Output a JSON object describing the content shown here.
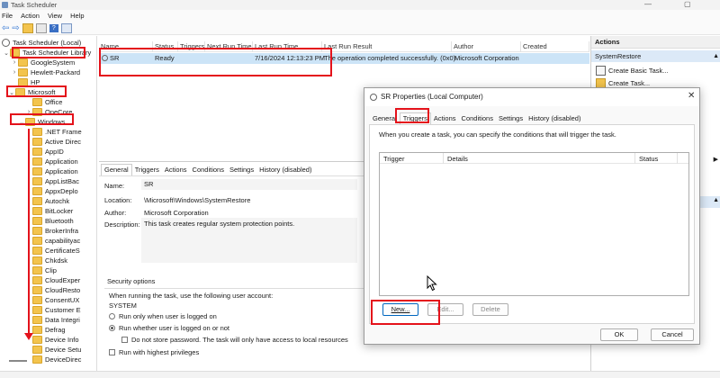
{
  "window": {
    "title": "Task Scheduler"
  },
  "menu": {
    "file": "File",
    "action": "Action",
    "view": "View",
    "help": "Help"
  },
  "tree": {
    "root": "Task Scheduler (Local)",
    "library": "Task Scheduler Library",
    "googlesystem": "GoogleSystem",
    "hp_full": "Hewlett-Packard",
    "hp": "HP",
    "microsoft": "Microsoft",
    "office": "Office",
    "onecore": "OneCore",
    "windows": "Windows",
    "children": [
      ".NET Frame",
      "Active Direc",
      "AppID",
      "Application",
      "Application",
      "AppListBac",
      "AppxDeplo",
      "Autochk",
      "BitLocker",
      "Bluetooth",
      "BrokerInfra",
      "capabilityac",
      "CertificateS",
      "Chkdsk",
      "Clip",
      "CloudExper",
      "CloudResto",
      "ConsentUX",
      "Customer E",
      "Data Integri",
      "Defrag",
      "Device Info",
      "Device Setu",
      "DeviceDirec"
    ]
  },
  "tasklist": {
    "columns": [
      "Name",
      "Status",
      "Triggers",
      "Next Run Time",
      "Last Run Time",
      "Last Run Result",
      "Author",
      "Created"
    ],
    "row": {
      "name": "SR",
      "status": "Ready",
      "last_run": "7/16/2024 12:13:23 PM",
      "result": "The operation completed successfully. (0x0)",
      "author": "Microsoft Corporation"
    }
  },
  "details": {
    "tabs": [
      "General",
      "Triggers",
      "Actions",
      "Conditions",
      "Settings",
      "History (disabled)"
    ],
    "name_label": "Name:",
    "name_value": "SR",
    "location_label": "Location:",
    "location_value": "\\Microsoft\\Windows\\SystemRestore",
    "author_label": "Author:",
    "author_value": "Microsoft Corporation",
    "desc_label": "Description:",
    "desc_value": "This task creates regular system protection points.",
    "security_title": "Security options",
    "security_account_label": "When running the task, use the following user account:",
    "account": "SYSTEM",
    "opt_logged_on": "Run only when user is logged on",
    "opt_logged_or_not": "Run whether user is logged on or not",
    "opt_no_password": "Do not store password.  The task will only have access to local resources",
    "opt_highest": "Run with highest privileges"
  },
  "actions": {
    "header": "Actions",
    "section": "SystemRestore",
    "items": [
      "Create Basic Task...",
      "Create Task..."
    ]
  },
  "dialog": {
    "title": "SR Properties (Local Computer)",
    "tabs": [
      "General",
      "Triggers",
      "Actions",
      "Conditions",
      "Settings",
      "History (disabled)"
    ],
    "description": "When you create a task, you can specify the conditions that will trigger the task.",
    "columns": [
      "Trigger",
      "Details",
      "Status"
    ],
    "new": "New...",
    "edit": "Edit...",
    "delete": "Delete",
    "ok": "OK",
    "cancel": "Cancel"
  },
  "colors": {
    "highlight_red": "#e4121b",
    "selection": "#cce4f7",
    "folder": "#f3c44d"
  }
}
